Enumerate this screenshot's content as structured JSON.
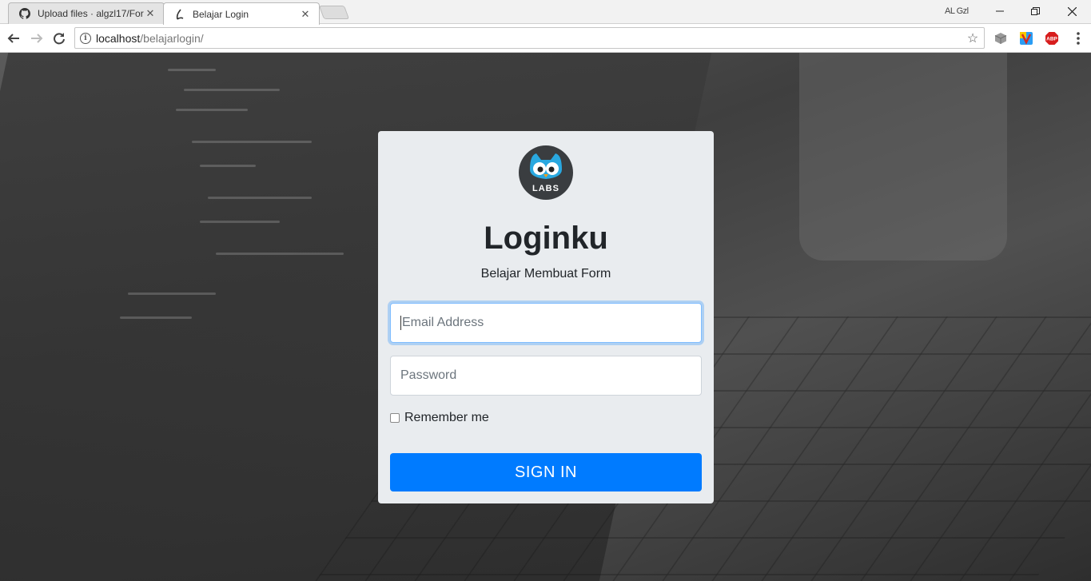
{
  "browser": {
    "tabs": [
      {
        "title": "Upload files · algzl17/For",
        "icon": "github-icon"
      },
      {
        "title": "Belajar Login",
        "icon": "page-favicon"
      }
    ],
    "close_glyph": "✕",
    "user_label": "AL Gzl",
    "address": {
      "host": "localhost",
      "path": "/belajarlogin/"
    },
    "extensions": [
      "extension-cube-icon",
      "extension-v-icon",
      "adblock-plus-icon"
    ]
  },
  "login": {
    "logo_text": "LABS",
    "title": "Loginku",
    "subtitle": "Belajar Membuat Form",
    "email_placeholder": "Email Address",
    "password_placeholder": "Password",
    "remember_label": "Remember me",
    "signin_label": "SIGN IN"
  },
  "colors": {
    "accent": "#007bff",
    "card": "#e9ecef",
    "logo_owl": "#29a8e0"
  }
}
